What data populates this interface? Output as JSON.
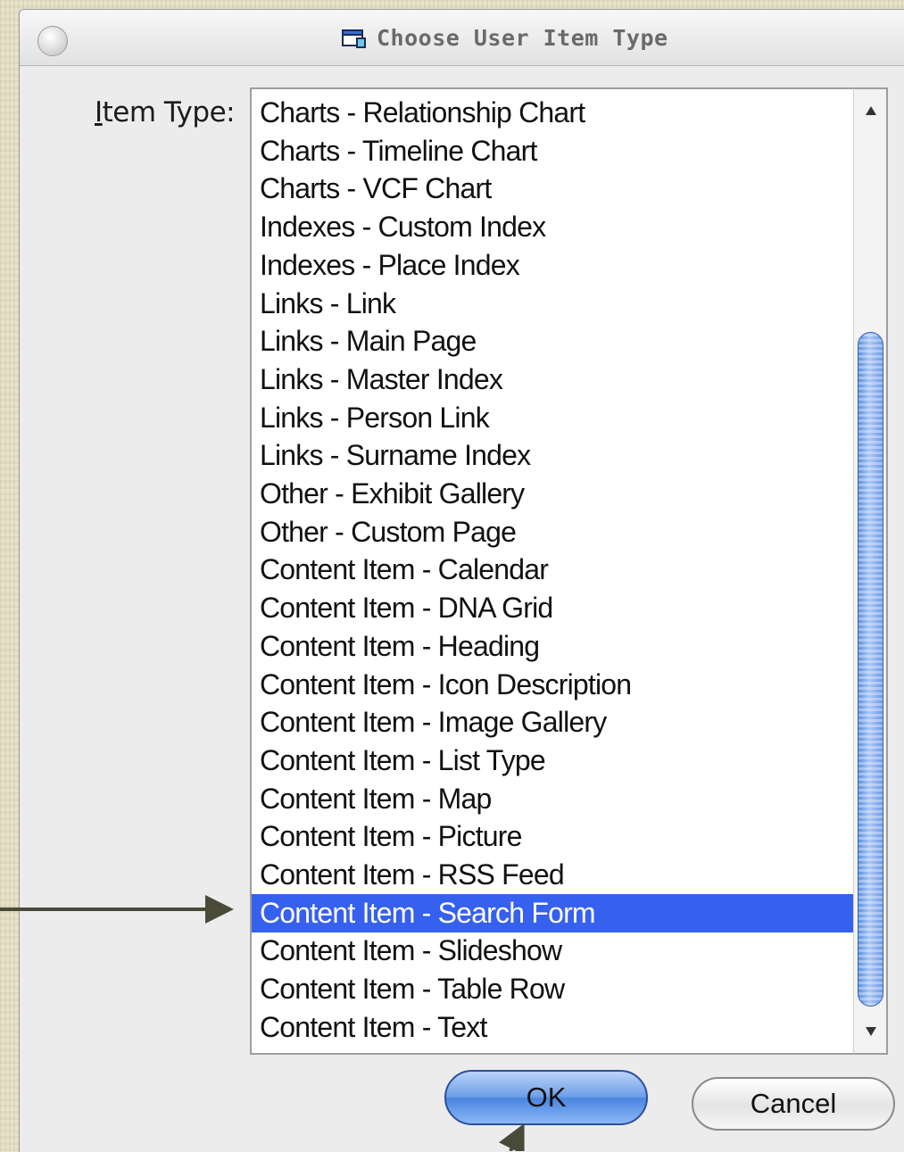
{
  "dialog": {
    "title": "Choose User Item Type",
    "item_type_label_mnemonic": "I",
    "item_type_label_rest": "tem Type:",
    "ok_label": "OK",
    "cancel_label": "Cancel"
  },
  "list": {
    "items": [
      "Charts - Relationship Chart",
      "Charts - Timeline Chart",
      "Charts - VCF Chart",
      "Indexes - Custom Index",
      "Indexes - Place Index",
      "Links - Link",
      "Links - Main Page",
      "Links - Master Index",
      "Links - Person Link",
      "Links - Surname Index",
      "Other - Exhibit Gallery",
      "Other - Custom Page",
      "Content Item - Calendar",
      "Content Item - DNA Grid",
      "Content Item - Heading",
      "Content Item - Icon Description",
      "Content Item - Image Gallery",
      "Content Item - List Type",
      "Content Item - Map",
      "Content Item - Picture",
      "Content Item - RSS Feed",
      "Content Item - Search Form",
      "Content Item - Slideshow",
      "Content Item - Table Row",
      "Content Item - Text"
    ],
    "selected": "Content Item - Search Form"
  },
  "colors": {
    "selection": "#3660ee",
    "annotation_arrow": "#4a4a38"
  },
  "icons": {
    "title": "folder-window-icon",
    "scroll_up": "triangle-up-icon",
    "scroll_down": "triangle-down-icon"
  }
}
